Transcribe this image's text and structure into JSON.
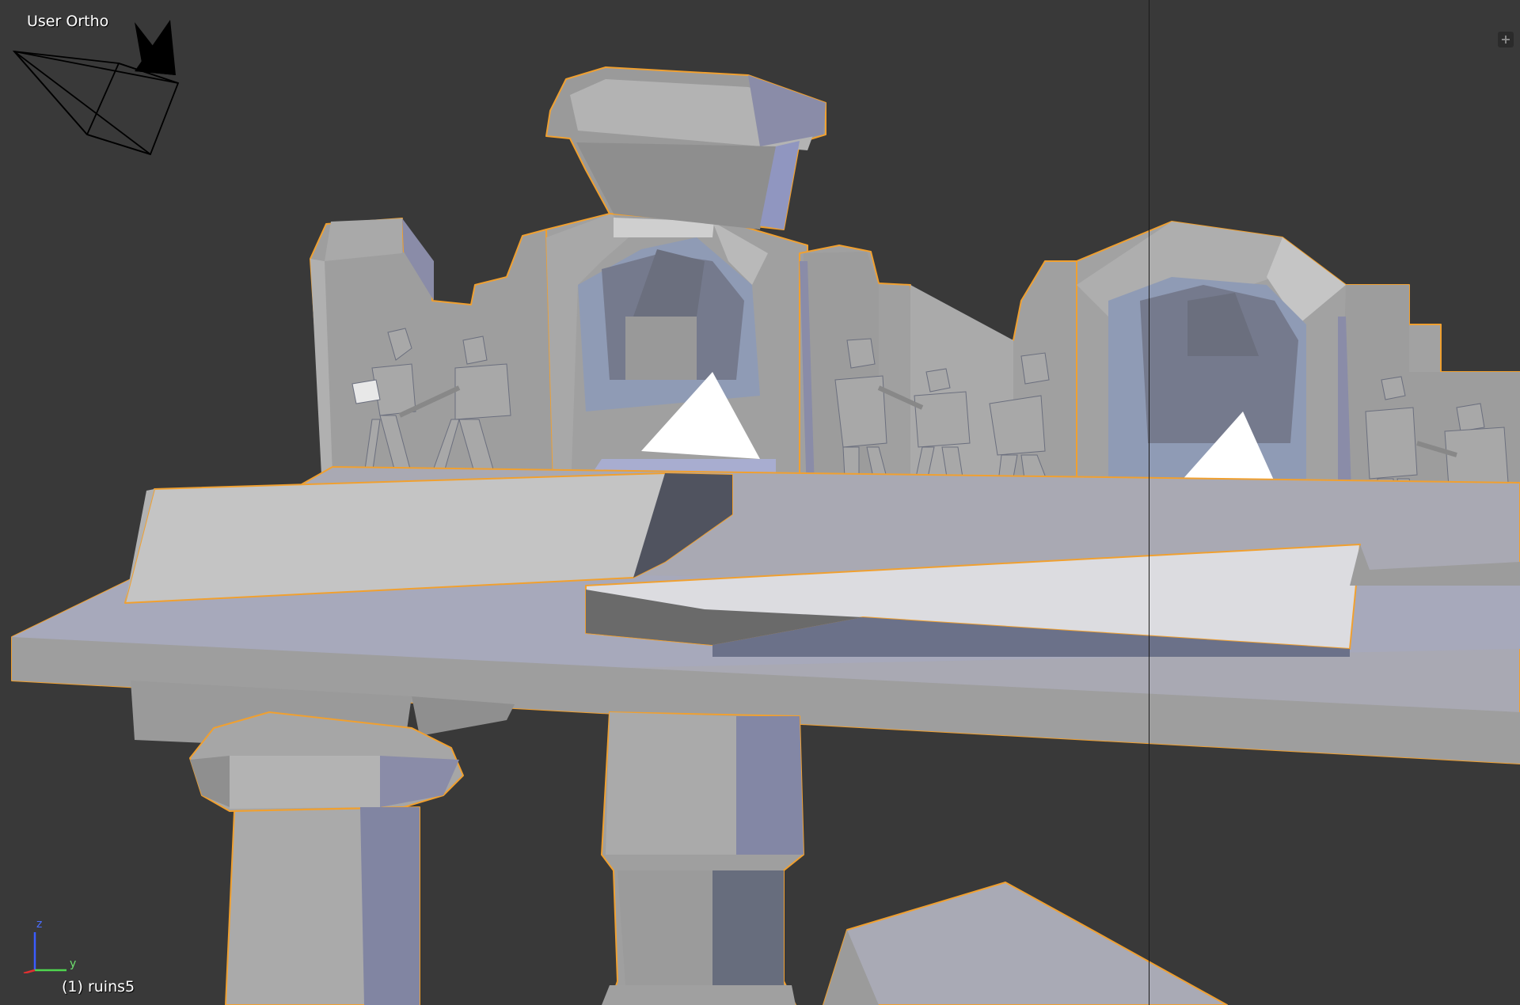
{
  "viewport": {
    "view_name": "User Ortho",
    "active_object": "(1) ruins5",
    "axes": {
      "z_label": "z",
      "y_label": "y"
    },
    "toggle_label": "+"
  },
  "colors": {
    "background": "#393939",
    "selection_outline": "#f0a030",
    "mesh_light": "#aaaaaa",
    "mesh_shadow": "#7f819f",
    "mesh_dark": "#555a66",
    "highlight": "#ffffff"
  },
  "icons": {
    "camera": "camera-gizmo-icon",
    "axes": "axis-gizmo-icon",
    "toggle": "plus-icon"
  }
}
